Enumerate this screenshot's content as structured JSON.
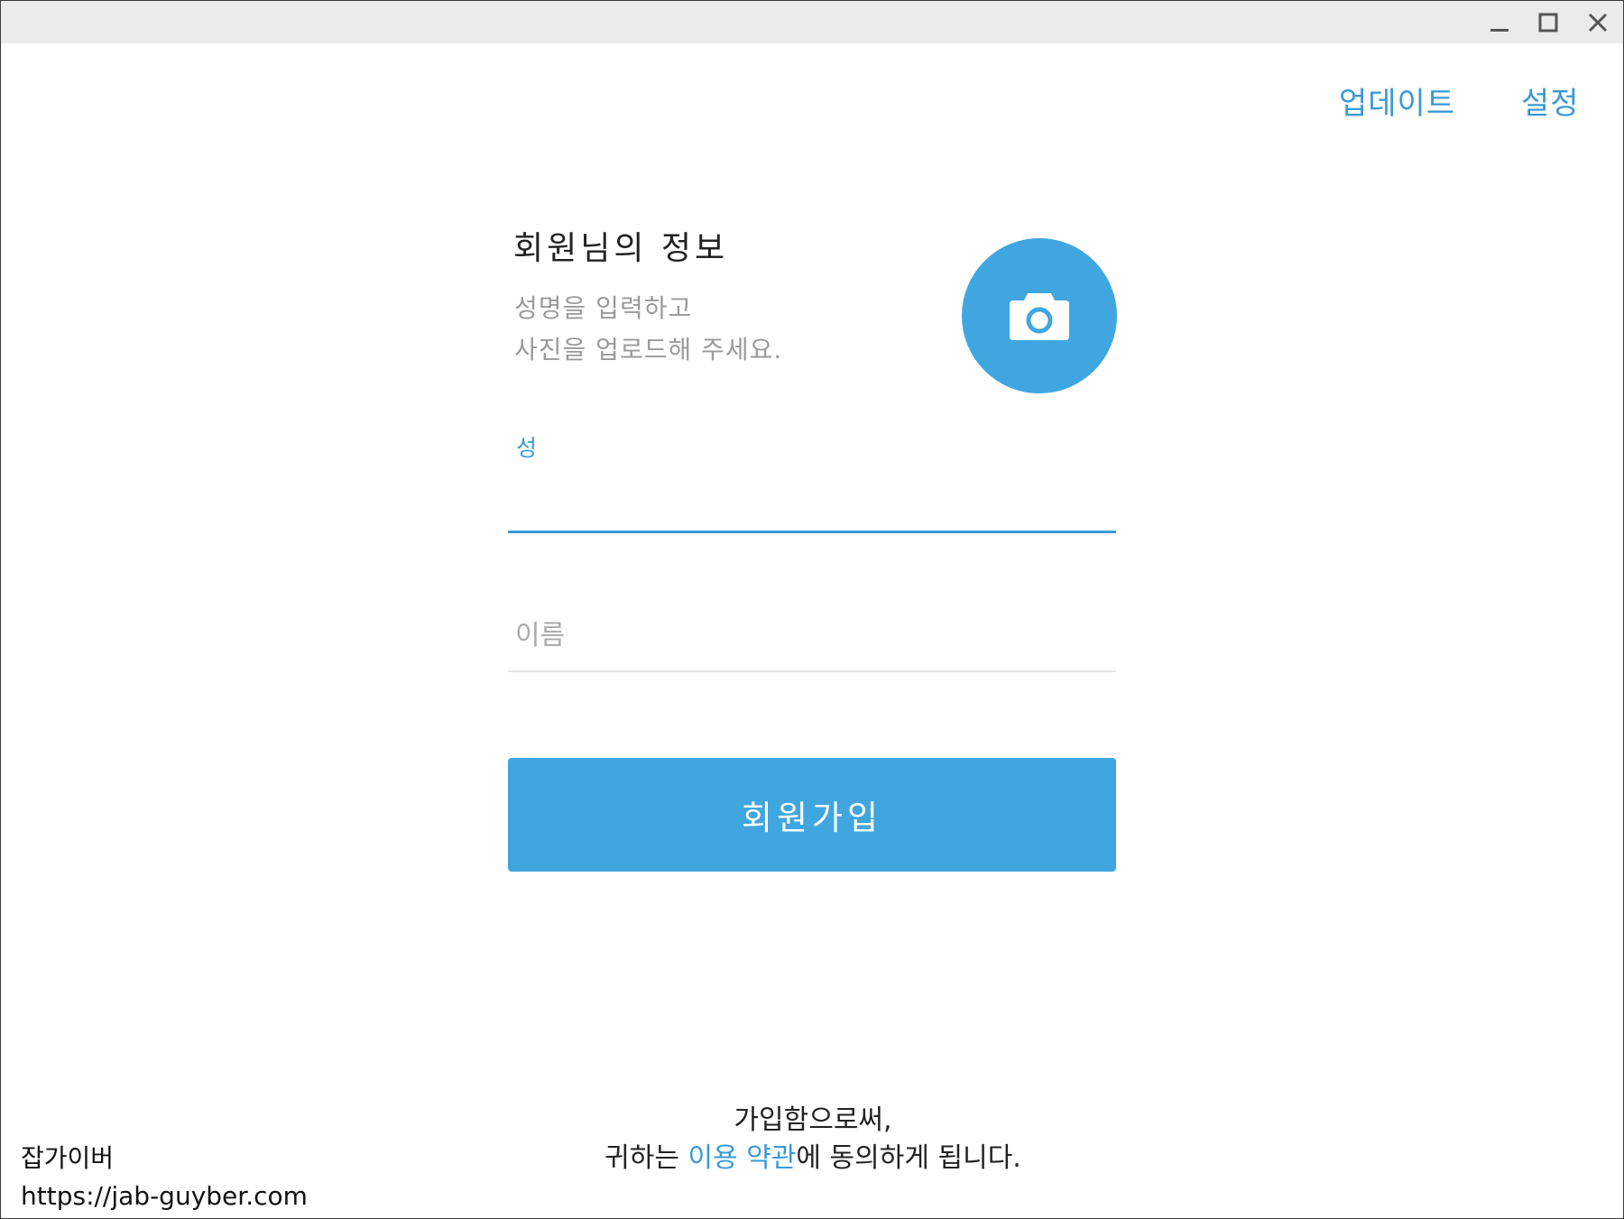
{
  "window_controls": {
    "minimize_icon": "minimize-icon",
    "maximize_icon": "maximize-icon",
    "close_icon": "close-icon"
  },
  "header": {
    "update_label": "업데이트",
    "settings_label": "설정"
  },
  "profile": {
    "title": "회원님의 정보",
    "subtitle_line1": "성명을 입력하고",
    "subtitle_line2": "사진을 업로드해 주세요.",
    "photo_icon": "camera-icon"
  },
  "form": {
    "last_name_label": "성",
    "last_name_value": "",
    "first_name_placeholder": "이름",
    "first_name_value": "",
    "submit_label": "회원가입"
  },
  "terms": {
    "line1": "가입함으로써,",
    "prefix": "귀하는 ",
    "link_text": "이용 약관",
    "suffix": "에 동의하게 됩니다."
  },
  "watermark": {
    "name": "잡가이버",
    "url": "https://jab-guyber.com"
  },
  "colors": {
    "accent": "#40a6e0",
    "link": "#3a9ad6",
    "muted_text": "#9a9a9a",
    "titlebar": "#ebebeb"
  }
}
